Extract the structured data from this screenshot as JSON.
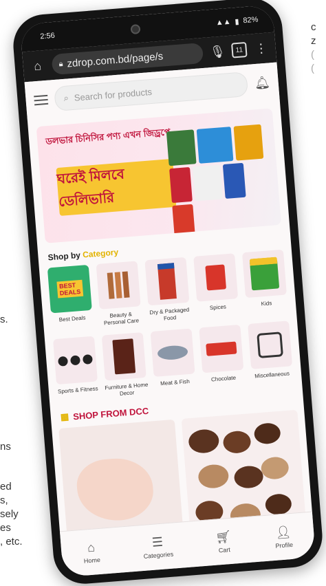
{
  "background_text": {
    "right_top": [
      "c",
      "z",
      "(",
      "("
    ],
    "left_frag1": "s.",
    "left_frag2": "ns",
    "left_frag3": [
      "ed",
      "s,",
      "sely",
      "es",
      ", etc."
    ]
  },
  "status_bar": {
    "time": "2:56",
    "battery": "82%"
  },
  "browser": {
    "url": "zdrop.com.bd/page/s",
    "tab_count": "11"
  },
  "app": {
    "search_placeholder": "Search for products",
    "banner_headline": "ডলভার চিনিসির পণ্য এখন জিড্রপে",
    "banner_yellow_text": "ঘরেই মিলবে ডেলিভারি",
    "shop_by": "Shop by",
    "shop_by_accent": "Category",
    "shop_from": "SHOP FROM DCC"
  },
  "categories": [
    {
      "label": "Best Deals",
      "icon": "best-deals"
    },
    {
      "label": "Beauty & Personal Care",
      "icon": "bottles"
    },
    {
      "label": "Dry & Packaged Food",
      "icon": "packet"
    },
    {
      "label": "Spices",
      "icon": "spice-packet"
    },
    {
      "label": "Kids",
      "icon": "diapers"
    },
    {
      "label": "Sports & Fitness",
      "icon": "dumbbells"
    },
    {
      "label": "Furniture & Home Decor",
      "icon": "cabinet"
    },
    {
      "label": "Meat & Fish",
      "icon": "fish"
    },
    {
      "label": "Chocolate",
      "icon": "chocolate"
    },
    {
      "label": "Miscellaneous",
      "icon": "misc"
    }
  ],
  "nav": [
    {
      "label": "Home",
      "icon": "home-icon"
    },
    {
      "label": "Categories",
      "icon": "categories-icon"
    },
    {
      "label": "Cart",
      "icon": "cart-icon"
    },
    {
      "label": "Profile",
      "icon": "profile-icon"
    }
  ]
}
